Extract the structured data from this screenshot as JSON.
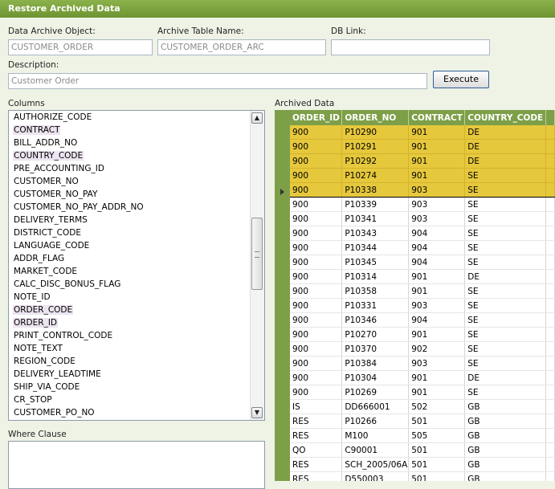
{
  "title": "Restore Archived Data",
  "form": {
    "archive_object_label": "Data Archive Object:",
    "archive_object_value": "CUSTOMER_ORDER",
    "archive_table_label": "Archive Table Name:",
    "archive_table_value": "CUSTOMER_ORDER_ARC",
    "db_link_label": "DB Link:",
    "db_link_value": "",
    "description_label": "Description:",
    "description_value": "Customer Order",
    "execute_label": "Execute"
  },
  "columns": {
    "label": "Columns",
    "items": [
      {
        "name": "AUTHORIZE_CODE",
        "selected": false
      },
      {
        "name": "CONTRACT",
        "selected": true
      },
      {
        "name": "BILL_ADDR_NO",
        "selected": false
      },
      {
        "name": "COUNTRY_CODE",
        "selected": true
      },
      {
        "name": "PRE_ACCOUNTING_ID",
        "selected": false
      },
      {
        "name": "CUSTOMER_NO",
        "selected": false
      },
      {
        "name": "CUSTOMER_NO_PAY",
        "selected": false
      },
      {
        "name": "CUSTOMER_NO_PAY_ADDR_NO",
        "selected": false
      },
      {
        "name": "DELIVERY_TERMS",
        "selected": false
      },
      {
        "name": "DISTRICT_CODE",
        "selected": false
      },
      {
        "name": "LANGUAGE_CODE",
        "selected": false
      },
      {
        "name": "ADDR_FLAG",
        "selected": false
      },
      {
        "name": "MARKET_CODE",
        "selected": false
      },
      {
        "name": "CALC_DISC_BONUS_FLAG",
        "selected": false
      },
      {
        "name": "NOTE_ID",
        "selected": false
      },
      {
        "name": "ORDER_CODE",
        "selected": true
      },
      {
        "name": "ORDER_ID",
        "selected": true
      },
      {
        "name": "PRINT_CONTROL_CODE",
        "selected": false
      },
      {
        "name": "NOTE_TEXT",
        "selected": false
      },
      {
        "name": "REGION_CODE",
        "selected": false
      },
      {
        "name": "DELIVERY_LEADTIME",
        "selected": false
      },
      {
        "name": "SHIP_VIA_CODE",
        "selected": false
      },
      {
        "name": "CR_STOP",
        "selected": false
      },
      {
        "name": "CUSTOMER_PO_NO",
        "selected": false
      }
    ]
  },
  "where_clause": {
    "label": "Where Clause",
    "value": ""
  },
  "archived_data": {
    "label": "Archived Data",
    "headers": [
      "ORDER_ID",
      "ORDER_NO",
      "CONTRACT",
      "COUNTRY_CODE"
    ],
    "rows": [
      [
        "900",
        "P10290",
        "901",
        "DE"
      ],
      [
        "900",
        "P10291",
        "901",
        "DE"
      ],
      [
        "900",
        "P10292",
        "901",
        "DE"
      ],
      [
        "900",
        "P10274",
        "901",
        "SE"
      ],
      [
        "900",
        "P10338",
        "903",
        "SE"
      ],
      [
        "900",
        "P10339",
        "903",
        "SE"
      ],
      [
        "900",
        "P10341",
        "903",
        "SE"
      ],
      [
        "900",
        "P10343",
        "904",
        "SE"
      ],
      [
        "900",
        "P10344",
        "904",
        "SE"
      ],
      [
        "900",
        "P10345",
        "904",
        "SE"
      ],
      [
        "900",
        "P10314",
        "901",
        "DE"
      ],
      [
        "900",
        "P10358",
        "901",
        "SE"
      ],
      [
        "900",
        "P10331",
        "903",
        "SE"
      ],
      [
        "900",
        "P10346",
        "904",
        "SE"
      ],
      [
        "900",
        "P10270",
        "901",
        "SE"
      ],
      [
        "900",
        "P10370",
        "902",
        "SE"
      ],
      [
        "900",
        "P10384",
        "903",
        "SE"
      ],
      [
        "900",
        "P10304",
        "901",
        "DE"
      ],
      [
        "900",
        "P10269",
        "901",
        "SE"
      ],
      [
        "IS",
        "DD666001",
        "502",
        "GB"
      ],
      [
        "RES",
        "P10266",
        "501",
        "GB"
      ],
      [
        "RES",
        "M100",
        "505",
        "GB"
      ],
      [
        "QO",
        "C90001",
        "501",
        "GB"
      ],
      [
        "RES",
        "SCH_2005/06A",
        "501",
        "GB"
      ],
      [
        "RES",
        "D550003",
        "501",
        "GB"
      ]
    ],
    "highlighted_rows": [
      0,
      1,
      2,
      3,
      4
    ],
    "current_row": 4
  }
}
